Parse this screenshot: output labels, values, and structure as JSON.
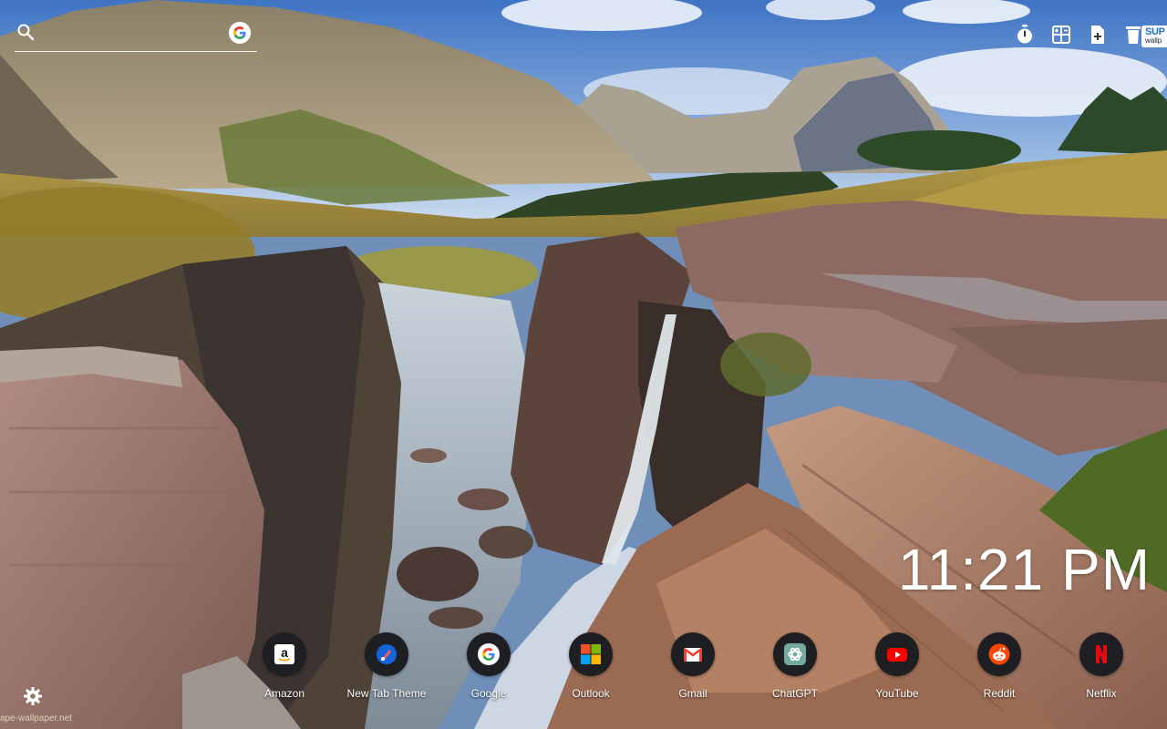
{
  "search": {
    "placeholder": ""
  },
  "toolbar": {
    "items": [
      {
        "icon": "timer-icon"
      },
      {
        "icon": "apps-grid-icon"
      },
      {
        "icon": "add-file-icon"
      },
      {
        "icon": "trash-icon"
      }
    ],
    "brand": {
      "line1": "SUP",
      "line2": "wallp"
    }
  },
  "clock": {
    "time": "11:21 PM"
  },
  "shortcuts": [
    {
      "label": "Amazon",
      "icon": "amazon-icon"
    },
    {
      "label": "New Tab Theme",
      "icon": "new-tab-theme-icon"
    },
    {
      "label": "Google",
      "icon": "google-icon"
    },
    {
      "label": "Outlook",
      "icon": "outlook-icon"
    },
    {
      "label": "Gmail",
      "icon": "gmail-icon"
    },
    {
      "label": "ChatGPT",
      "icon": "chatgpt-icon"
    },
    {
      "label": "YouTube",
      "icon": "youtube-icon"
    },
    {
      "label": "Reddit",
      "icon": "reddit-icon"
    },
    {
      "label": "Netflix",
      "icon": "netflix-icon"
    }
  ],
  "footer": {
    "watermark": "ape-wallpaper.net"
  },
  "colors": {
    "shortcut_bg": "#1d1f22",
    "text": "#ffffff"
  }
}
